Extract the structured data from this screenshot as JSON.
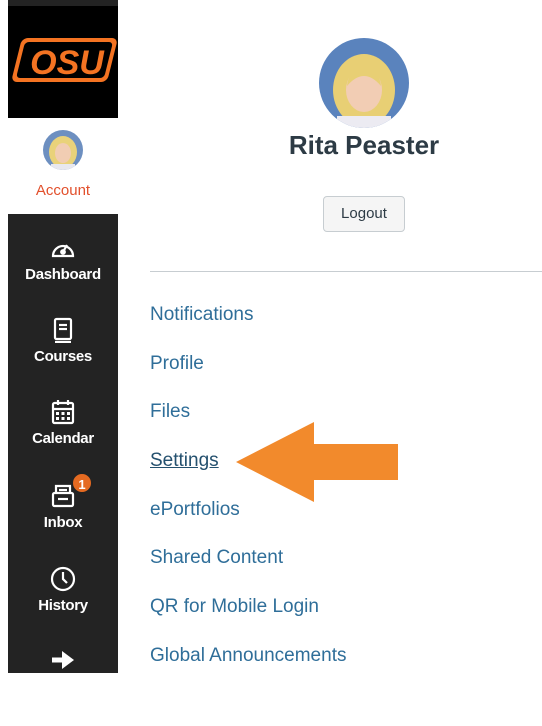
{
  "nav": {
    "logo_text": "OSU",
    "account_label": "Account",
    "items": [
      {
        "label": "Dashboard",
        "icon": "dashboard-icon"
      },
      {
        "label": "Courses",
        "icon": "courses-icon"
      },
      {
        "label": "Calendar",
        "icon": "calendar-icon"
      },
      {
        "label": "Inbox",
        "icon": "inbox-icon",
        "badge": "1"
      },
      {
        "label": "History",
        "icon": "history-icon"
      },
      {
        "label": "",
        "icon": "logout-arrow-icon"
      }
    ]
  },
  "tray": {
    "user_name": "Rita Peaster",
    "logout_label": "Logout",
    "links": [
      {
        "label": "Notifications"
      },
      {
        "label": "Profile"
      },
      {
        "label": "Files"
      },
      {
        "label": "Settings",
        "selected": true
      },
      {
        "label": "ePortfolios"
      },
      {
        "label": "Shared Content"
      },
      {
        "label": "QR for Mobile Login"
      },
      {
        "label": "Global Announcements"
      }
    ]
  },
  "colors": {
    "nav_bg": "#232323",
    "accent_orange": "#e2502c",
    "link_blue": "#2f6e99",
    "callout_arrow": "#f28a2c"
  }
}
